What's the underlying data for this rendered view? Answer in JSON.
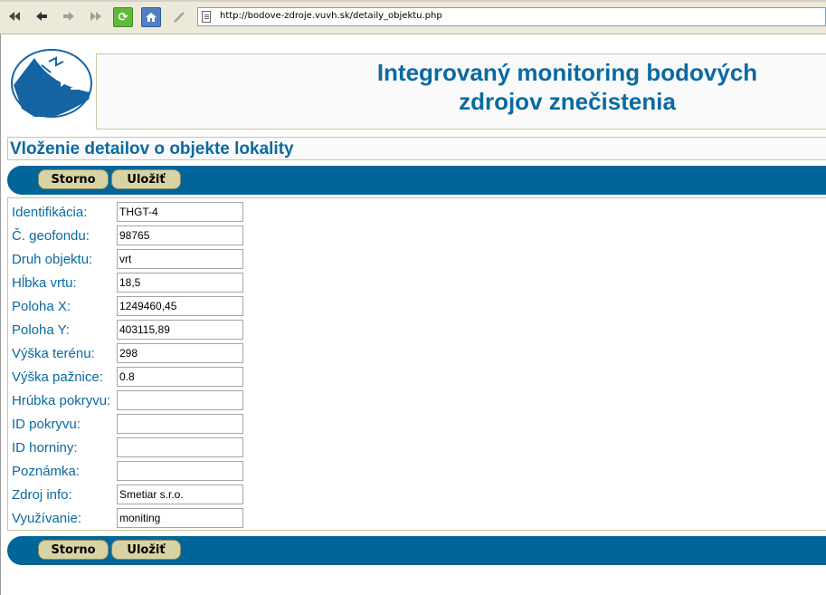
{
  "browser": {
    "url": "http://bodove-zdroje.vuvh.sk/detaily_objektu.php"
  },
  "header": {
    "title_line1": "Integrovaný monitoring bodových",
    "title_line2": "zdrojov znečistenia"
  },
  "page": {
    "section_title": "Vloženie detailov o objekte lokality"
  },
  "actions": {
    "cancel_label": "Storno",
    "save_label": "Uložiť"
  },
  "form": {
    "fields": [
      {
        "label": "Identifikácia:",
        "value": "THGT-4"
      },
      {
        "label": "Č. geofondu:",
        "value": "98765"
      },
      {
        "label": "Druh objektu:",
        "value": "vrt"
      },
      {
        "label": "Hĺbka vrtu:",
        "value": "18,5"
      },
      {
        "label": "Poloha X:",
        "value": "1249460,45"
      },
      {
        "label": "Poloha Y:",
        "value": "403115,89"
      },
      {
        "label": "Výška terénu:",
        "value": "298"
      },
      {
        "label": "Výška pažnice:",
        "value": "0.8"
      },
      {
        "label": "Hrúbka pokryvu:",
        "value": ""
      },
      {
        "label": "ID pokryvu:",
        "value": ""
      },
      {
        "label": "ID horniny:",
        "value": ""
      },
      {
        "label": "Poznámka:",
        "value": ""
      },
      {
        "label": "Zdroj info:",
        "value": "Smetiar s.r.o."
      },
      {
        "label": "Využívanie:",
        "value": "moniting"
      }
    ]
  },
  "colors": {
    "accent": "#006699",
    "label_text": "#0a6aa1",
    "button_bg": "#d8d3a4"
  }
}
